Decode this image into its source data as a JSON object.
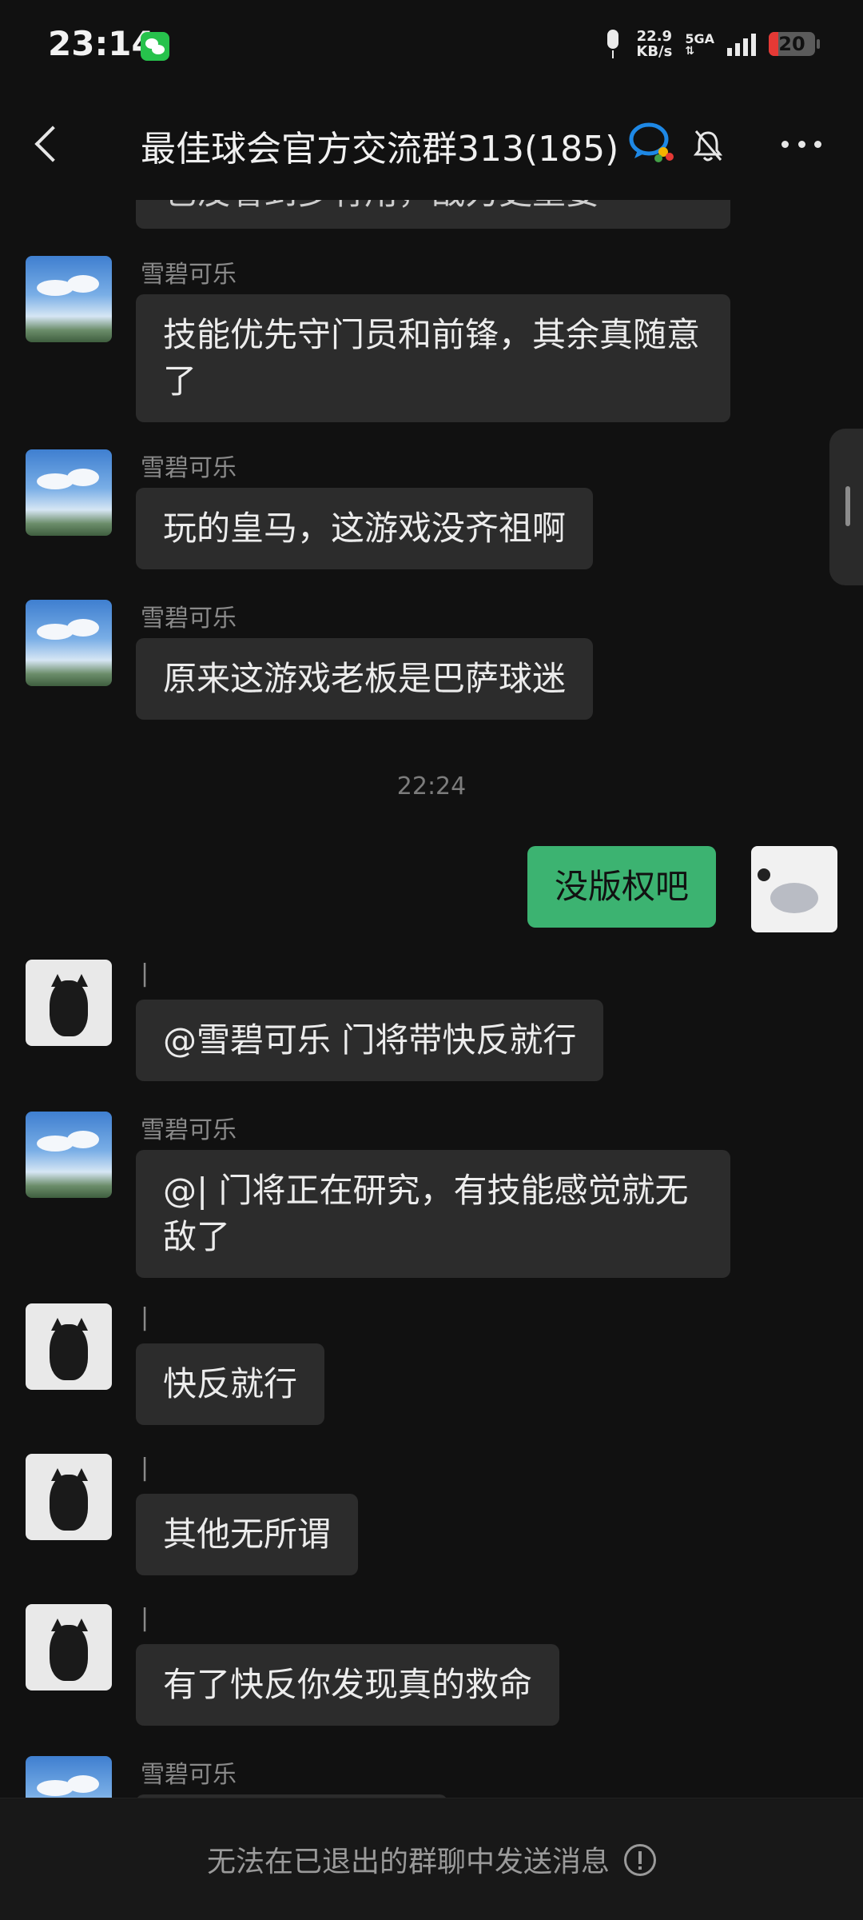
{
  "status_bar": {
    "time": "23:14",
    "net_speed_value": "22.9",
    "net_speed_unit": "KB/s",
    "network": "5GA",
    "battery": "20",
    "icons": [
      "wechat-icon",
      "mic-icon",
      "signal-icon",
      "battery-icon"
    ]
  },
  "header": {
    "title": "最佳球会官方交流群313(185)",
    "icons": [
      "back-icon",
      "chat-bubble-icon",
      "mute-bell-icon",
      "more-icon"
    ]
  },
  "messages": [
    {
      "type": "incoming",
      "sender": "",
      "text": "也没看到多有用，战力更重要",
      "avatar": "sky-lake"
    },
    {
      "type": "incoming",
      "sender": "雪碧可乐",
      "text": "技能优先守门员和前锋，其余真随意了",
      "avatar": "sky-lake"
    },
    {
      "type": "incoming",
      "sender": "雪碧可乐",
      "text": "玩的皇马，这游戏没齐祖啊",
      "avatar": "sky-lake"
    },
    {
      "type": "incoming",
      "sender": "雪碧可乐",
      "text": "原来这游戏老板是巴萨球迷",
      "avatar": "sky-lake"
    },
    {
      "type": "timestamp",
      "text": "22:24"
    },
    {
      "type": "outgoing",
      "text": "没版权吧",
      "avatar": "plush-fish"
    },
    {
      "type": "incoming",
      "sender": "|",
      "text": "@雪碧可乐  门将带快反就行",
      "avatar": "black-cat"
    },
    {
      "type": "incoming",
      "sender": "雪碧可乐",
      "text": "@|  门将正在研究，有技能感觉就无敌了",
      "avatar": "sky-lake"
    },
    {
      "type": "incoming",
      "sender": "|",
      "text": "快反就行",
      "avatar": "black-cat"
    },
    {
      "type": "incoming",
      "sender": "|",
      "text": "其他无所谓",
      "avatar": "black-cat"
    },
    {
      "type": "incoming",
      "sender": "|",
      "text": "有了快反你发现真的救命",
      "avatar": "black-cat"
    },
    {
      "type": "incoming",
      "sender": "雪碧可乐",
      "text": "",
      "avatar": "sky-lake"
    }
  ],
  "footer": {
    "text": "无法在已退出的群聊中发送消息"
  }
}
